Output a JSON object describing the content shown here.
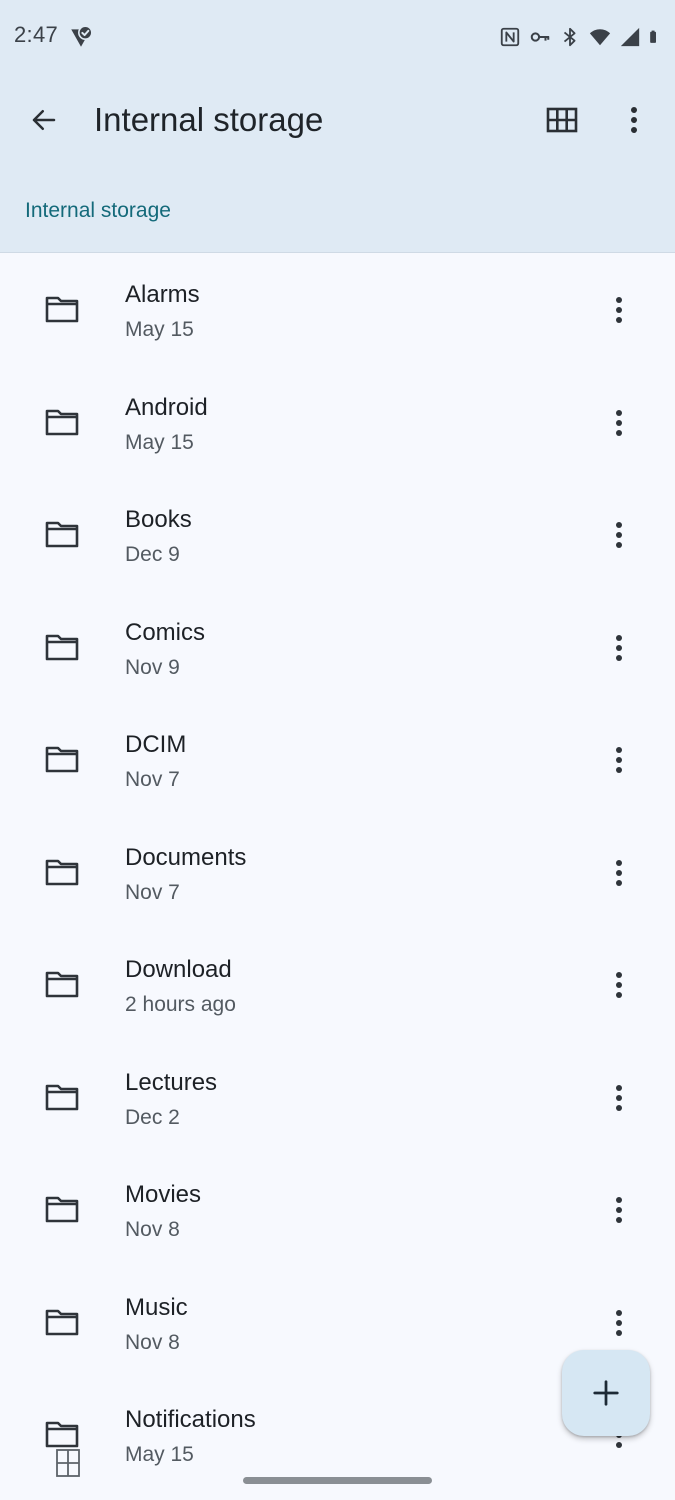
{
  "status_bar": {
    "time": "2:47"
  },
  "app_bar": {
    "title": "Internal storage"
  },
  "breadcrumb": {
    "label": "Internal storage"
  },
  "files": [
    {
      "name": "Alarms",
      "date": "May 15"
    },
    {
      "name": "Android",
      "date": "May 15"
    },
    {
      "name": "Books",
      "date": "Dec 9"
    },
    {
      "name": "Comics",
      "date": "Nov 9"
    },
    {
      "name": "DCIM",
      "date": "Nov 7"
    },
    {
      "name": "Documents",
      "date": "Nov 7"
    },
    {
      "name": "Download",
      "date": "2 hours ago"
    },
    {
      "name": "Lectures",
      "date": "Dec 2"
    },
    {
      "name": "Movies",
      "date": "Nov 8"
    },
    {
      "name": "Music",
      "date": "Nov 8"
    },
    {
      "name": "Notifications",
      "date": "May 15"
    }
  ],
  "colors": {
    "header_background": "#dfeaf4",
    "list_background": "#f7f9fe",
    "accent": "#146a7a",
    "fab_background": "#d6e7f3"
  },
  "icons": {
    "back": "arrow-back-icon",
    "view_toggle": "grid-view-icon",
    "more": "more-vert-icon",
    "folder": "folder-icon",
    "add": "add-icon"
  }
}
